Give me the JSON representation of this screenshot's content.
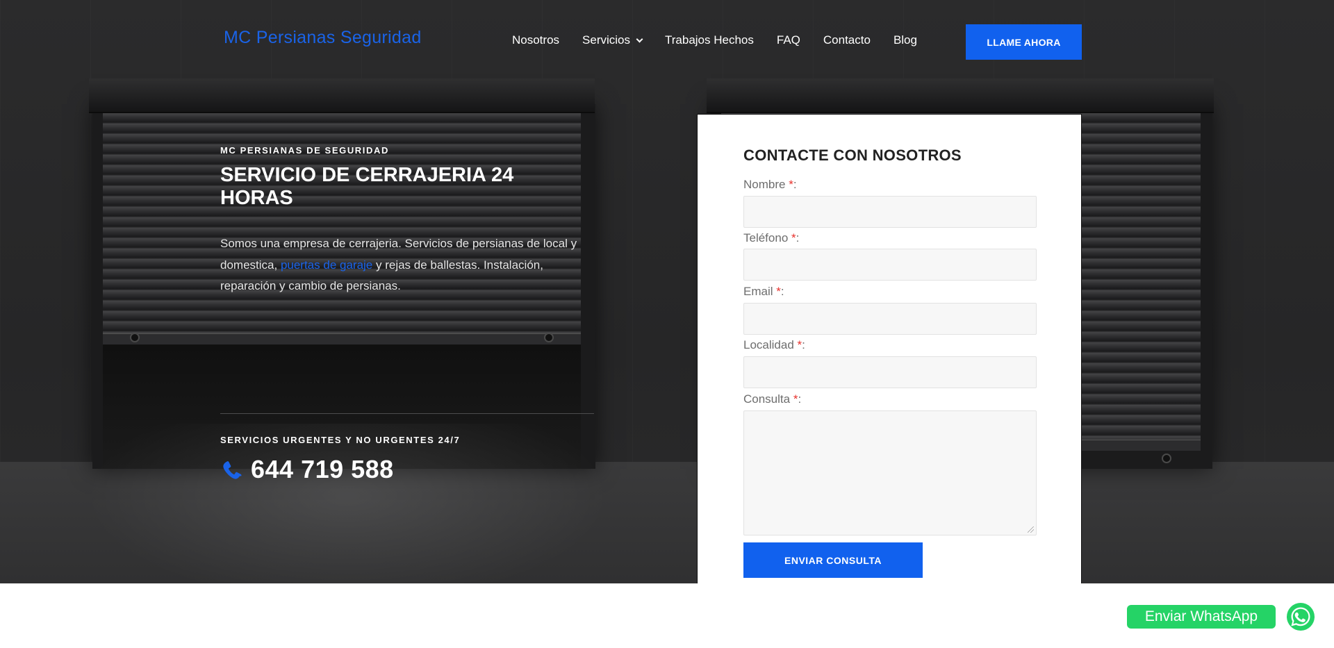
{
  "header": {
    "logo": "MC Persianas Seguridad",
    "nav": [
      "Nosotros",
      "Servicios",
      "Trabajos Hechos",
      "FAQ",
      "Contacto",
      "Blog"
    ],
    "cta": "LLAME AHORA"
  },
  "hero": {
    "eyebrow": "MC PERSIANAS DE SEGURIDAD",
    "headline": "SERVICIO DE CERRAJERIA 24 HORAS",
    "intro_before": "Somos una empresa de cerrajeria. Servicios de persianas de local y domestica, ",
    "intro_link": "puertas de garaje",
    "intro_after": " y rejas de ballestas. Instalación, reparación y cambio de persianas.",
    "eyebrow2": "SERVICIOS URGENTES Y NO URGENTES 24/7",
    "phone": "644 719 588"
  },
  "form": {
    "title": "CONTACTE CON NOSOTROS",
    "fields": [
      {
        "label": "Nombre",
        "req": "*",
        "colon": ":"
      },
      {
        "label": "Teléfono",
        "req": "*",
        "colon": ":"
      },
      {
        "label": "Email",
        "req": "*",
        "colon": ":"
      },
      {
        "label": "Localidad",
        "req": "*",
        "colon": ":"
      },
      {
        "label": "Consulta",
        "req": "*",
        "colon": ":"
      }
    ],
    "submit": "ENVIAR CONSULTA"
  },
  "whatsapp": {
    "label": "Enviar WhatsApp"
  },
  "colors": {
    "accent": "#1161ee",
    "whatsapp": "#25d366",
    "required": "#e8312c"
  },
  "icons": {
    "phone": "phone-icon",
    "whatsapp": "whatsapp-icon",
    "dropdown": "chevron-down-icon"
  }
}
